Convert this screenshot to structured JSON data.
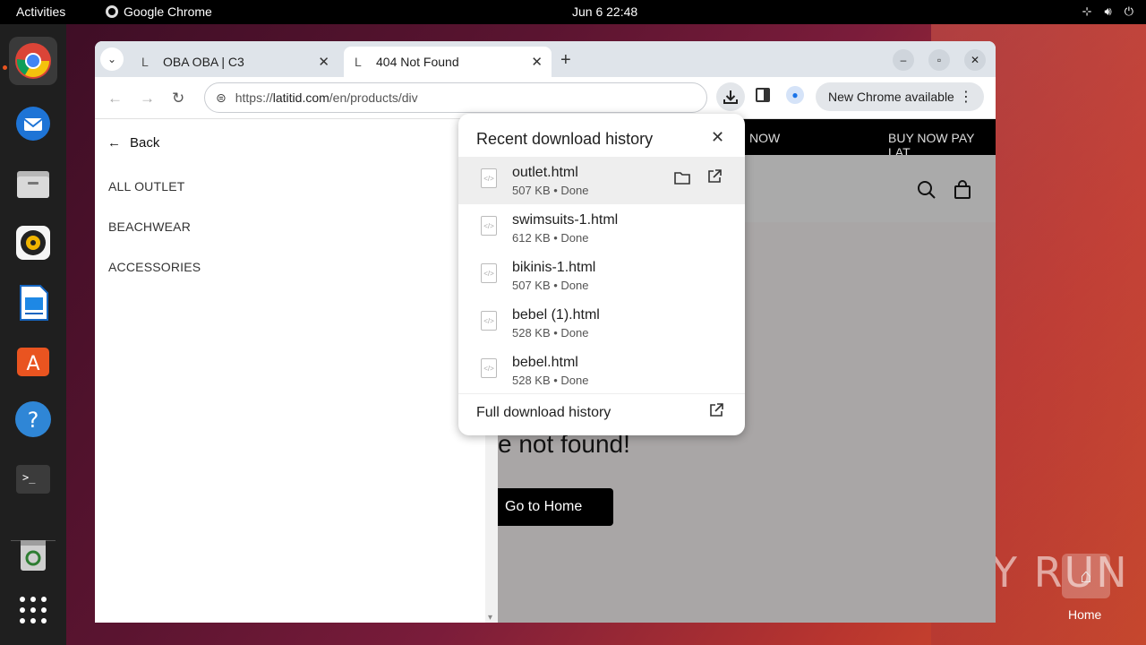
{
  "topbar": {
    "activities": "Activities",
    "app_name": "Google Chrome",
    "clock": "Jun 6  22:48"
  },
  "tabs": [
    {
      "title": "OBA OBA | C3"
    },
    {
      "title": "404 Not Found"
    }
  ],
  "toolbar": {
    "url_prefix": "https://",
    "url_domain": "latitid.com",
    "url_path": "/en/products/div",
    "new_chrome_label": "New Chrome available"
  },
  "sidebar": {
    "back_label": "Back",
    "items": [
      "ALL OUTLET",
      "BEACHWEAR",
      "ACCESSORIES"
    ]
  },
  "page": {
    "banner_left": "NOW",
    "banner_right": "BUY NOW PAY LAT",
    "not_found_text": "e not found!",
    "go_home_label": "Go to Home"
  },
  "downloads": {
    "title": "Recent download history",
    "items": [
      {
        "name": "outlet.html",
        "meta": "507 KB • Done"
      },
      {
        "name": "swimsuits-1.html",
        "meta": "612 KB • Done"
      },
      {
        "name": "bikinis-1.html",
        "meta": "507 KB • Done"
      },
      {
        "name": "bebel (1).html",
        "meta": "528 KB • Done"
      },
      {
        "name": "bebel.html",
        "meta": "528 KB • Done"
      }
    ],
    "footer_label": "Full download history"
  },
  "desktop": {
    "watermark": "ANY RUN",
    "home_label": "Home"
  }
}
